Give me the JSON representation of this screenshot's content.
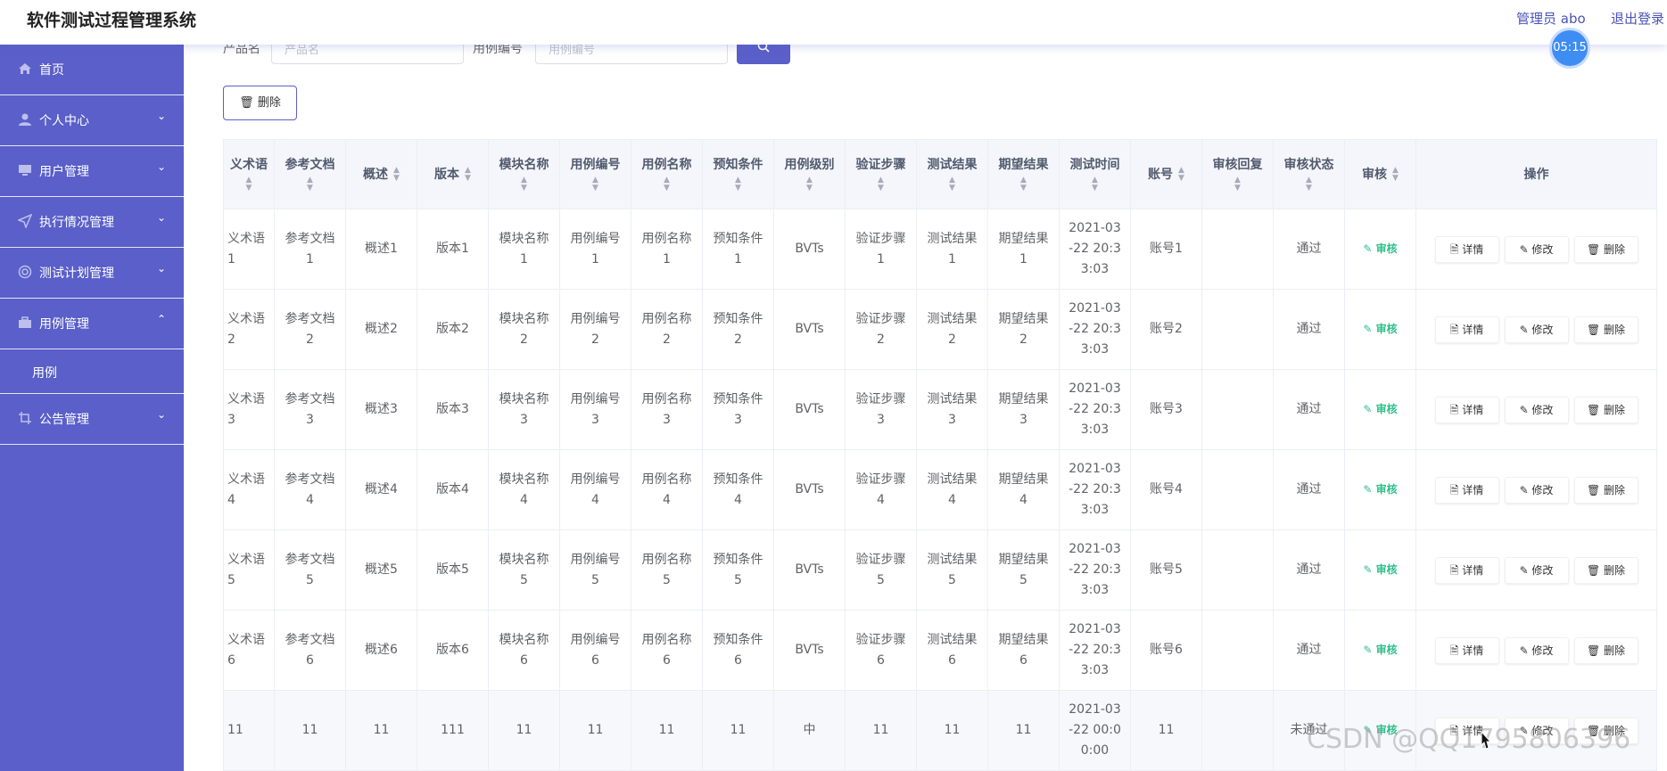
{
  "header": {
    "title": "软件测试过程管理系统",
    "admin": "管理员 abo",
    "logout": "退出登录",
    "clock": "05:15"
  },
  "sidebar": {
    "items": [
      {
        "label": "首页",
        "icon": "home-icon"
      },
      {
        "label": "个人中心",
        "icon": "user-icon"
      },
      {
        "label": "用户管理",
        "icon": "monitor-icon"
      },
      {
        "label": "执行情况管理",
        "icon": "send-icon"
      },
      {
        "label": "测试计划管理",
        "icon": "target-icon"
      },
      {
        "label": "用例管理",
        "icon": "briefcase-icon"
      },
      {
        "label": "用例",
        "icon": ""
      },
      {
        "label": "公告管理",
        "icon": "crop-icon"
      }
    ]
  },
  "search": {
    "product_label": "产品名",
    "product_placeholder": "产品名",
    "case_label": "用例编号",
    "case_placeholder": "用例编号"
  },
  "toolbar": {
    "delete_label": "删除"
  },
  "table": {
    "headers": [
      "义术语",
      "参考文档",
      "概述",
      "版本",
      "模块名称",
      "用例编号",
      "用例名称",
      "预知条件",
      "用例级别",
      "验证步骤",
      "测试结果",
      "期望结果",
      "测试时间",
      "账号",
      "审核回复",
      "审核状态",
      "审核",
      "操作"
    ],
    "audit_link": "审核",
    "ops": [
      "详情",
      "修改",
      "删除"
    ],
    "rows": [
      [
        "义术语\n1",
        "参考文档\n1",
        "概述1",
        "版本1",
        "模块名称\n1",
        "用例编号\n1",
        "用例名称\n1",
        "预知条件\n1",
        "BVTs",
        "验证步骤\n1",
        "测试结果\n1",
        "期望结果\n1",
        "2021-03\n-22 20:3\n3:03",
        "账号1",
        "",
        "通过"
      ],
      [
        "义术语\n2",
        "参考文档\n2",
        "概述2",
        "版本2",
        "模块名称\n2",
        "用例编号\n2",
        "用例名称\n2",
        "预知条件\n2",
        "BVTs",
        "验证步骤\n2",
        "测试结果\n2",
        "期望结果\n2",
        "2021-03\n-22 20:3\n3:03",
        "账号2",
        "",
        "通过"
      ],
      [
        "义术语\n3",
        "参考文档\n3",
        "概述3",
        "版本3",
        "模块名称\n3",
        "用例编号\n3",
        "用例名称\n3",
        "预知条件\n3",
        "BVTs",
        "验证步骤\n3",
        "测试结果\n3",
        "期望结果\n3",
        "2021-03\n-22 20:3\n3:03",
        "账号3",
        "",
        "通过"
      ],
      [
        "义术语\n4",
        "参考文档\n4",
        "概述4",
        "版本4",
        "模块名称\n4",
        "用例编号\n4",
        "用例名称\n4",
        "预知条件\n4",
        "BVTs",
        "验证步骤\n4",
        "测试结果\n4",
        "期望结果\n4",
        "2021-03\n-22 20:3\n3:03",
        "账号4",
        "",
        "通过"
      ],
      [
        "义术语\n5",
        "参考文档\n5",
        "概述5",
        "版本5",
        "模块名称\n5",
        "用例编号\n5",
        "用例名称\n5",
        "预知条件\n5",
        "BVTs",
        "验证步骤\n5",
        "测试结果\n5",
        "期望结果\n5",
        "2021-03\n-22 20:3\n3:03",
        "账号5",
        "",
        "通过"
      ],
      [
        "义术语\n6",
        "参考文档\n6",
        "概述6",
        "版本6",
        "模块名称\n6",
        "用例编号\n6",
        "用例名称\n6",
        "预知条件\n6",
        "BVTs",
        "验证步骤\n6",
        "测试结果\n6",
        "期望结果\n6",
        "2021-03\n-22 20:3\n3:03",
        "账号6",
        "",
        "通过"
      ],
      [
        "11",
        "11",
        "11",
        "111",
        "11",
        "11",
        "11",
        "11",
        "中",
        "11",
        "11",
        "11",
        "2021-03\n-22 00:0\n0:00",
        "11",
        "",
        "未通过"
      ]
    ]
  },
  "watermark": "CSDN @QQ1795806396",
  "colors": {
    "sidebar": "#5a5fc9",
    "accent": "#4a53b8",
    "audit": "#2fbf8b"
  }
}
